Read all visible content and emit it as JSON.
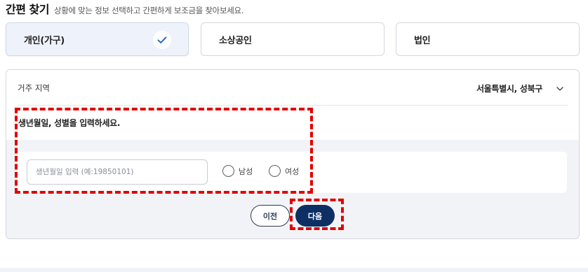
{
  "header": {
    "title": "간편 찾기",
    "subtitle": "상황에 맞는 정보 선택하고 간편하게 보조금을 찾아보세요."
  },
  "applicant_types": [
    {
      "label": "개인(가구)",
      "selected": true
    },
    {
      "label": "소상공인",
      "selected": false
    },
    {
      "label": "법인",
      "selected": false
    }
  ],
  "form": {
    "region_label": "거주 지역",
    "region_value": "서울특별시, 성북구",
    "prompt": "생년월일, 성별을 입력하세요.",
    "birth_placeholder": "생년월일 입력 (예:19850101)",
    "birth_value": "",
    "gender_options": [
      "남성",
      "여성"
    ]
  },
  "buttons": {
    "prev": "이전",
    "next": "다음"
  },
  "colors": {
    "primary": "#0e2f63",
    "check": "#2f6fcf",
    "highlight": "#e00000",
    "selected_bg": "#eef3fb"
  }
}
